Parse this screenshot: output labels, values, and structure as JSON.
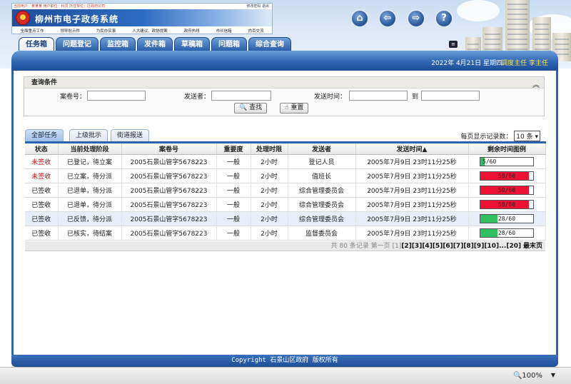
{
  "header": {
    "topnote": "当前用户：某某某  用户职位：科员  所在单位：区政府公司",
    "topnote_right": "修改密码  退出",
    "title": "柳州市电子政务系统",
    "shortcuts": [
      "全面重点工作",
      "领导批示件",
      "为民办实事",
      "人大建议、政协提案",
      "政府热线",
      "市长信箱",
      "内百交流"
    ],
    "icons": [
      "home-icon",
      "back-icon",
      "forward-icon",
      "help-icon"
    ],
    "icon_glyphs": [
      "⌂",
      "⇦",
      "⇨",
      "?"
    ]
  },
  "nav": {
    "tabs": [
      "任务箱",
      "问题登记",
      "监控箱",
      "发件箱",
      "草稿箱",
      "问题箱",
      "综合查询"
    ],
    "active": 0
  },
  "status": {
    "date": "2022年 4月21日 星期四",
    "role": "调度主任 李主任"
  },
  "query": {
    "title": "查询条件",
    "case_no_label": "案卷号：",
    "sender_label": "发送者：",
    "time_label": "发送时间：",
    "to_label": "到",
    "search_button": "查找",
    "reset_button": "重置"
  },
  "subtabs": [
    "全部任务",
    "上级批示",
    "街道报送"
  ],
  "perpage": {
    "label": "每页显示记录数：",
    "value": "10 条"
  },
  "table": {
    "columns": [
      "状态",
      "当前处理阶段",
      "案卷号",
      "重要度",
      "处理时限",
      "发送者",
      "发送时间▲",
      "剩余时间图例"
    ],
    "rows": [
      {
        "status": "未签收",
        "stage": "已登记，待立案",
        "case": "2005石景山管字5678223",
        "importance": "一般",
        "limit": "2小时",
        "sender": "登记人员",
        "time": "2005年7月9日  23时11分25秒",
        "remaining": "5/60",
        "fraction": 0.083,
        "color": "#30c060",
        "red": true
      },
      {
        "status": "未签收",
        "stage": "已立案，待分派",
        "case": "2005石景山管字5678223",
        "importance": "一般",
        "limit": "2小时",
        "sender": "值班长",
        "time": "2005年7月9日  23时11分25秒",
        "remaining": "50/60",
        "fraction": 0.92,
        "color": "#ee1133",
        "red": true
      },
      {
        "status": "已签收",
        "stage": "已退单，待分派",
        "case": "2005石景山管字5678223",
        "importance": "一般",
        "limit": "2小时",
        "sender": "综合管理委员会",
        "time": "2005年7月9日  23时11分25秒",
        "remaining": "50/60",
        "fraction": 0.92,
        "color": "#ee1133",
        "red": false
      },
      {
        "status": "已签收",
        "stage": "已退单，待分派",
        "case": "2005石景山管字5678223",
        "importance": "一般",
        "limit": "2小时",
        "sender": "综合管理委员会",
        "time": "2005年7月9日  23时11分25秒",
        "remaining": "50/60",
        "fraction": 0.92,
        "color": "#ee1133",
        "red": false
      },
      {
        "status": "已签收",
        "stage": "已反馈，待分派",
        "case": "2005石景山管字5678223",
        "importance": "一般",
        "limit": "2小时",
        "sender": "综合管理委员会",
        "time": "2005年7月9日  23时11分25秒",
        "remaining": "28/60",
        "fraction": 0.33,
        "color": "#30c060",
        "red": false,
        "highlight": true
      },
      {
        "status": "已签收",
        "stage": "已核实，待结案",
        "case": "2005石景山管字5678223",
        "importance": "一般",
        "limit": "2小时",
        "sender": "监督委员会",
        "time": "2005年7月9日  23时11分25秒",
        "remaining": "28/60",
        "fraction": 0.33,
        "color": "#30c060",
        "red": false
      }
    ]
  },
  "pager": {
    "summary": "共 80 条记录  第一页",
    "pages": [
      "[1]",
      "[2]",
      "[3]",
      "[4]",
      "[5]",
      "[6]",
      "[7]",
      "[8]",
      "[9]",
      "[10]",
      "...",
      "[20]"
    ],
    "last": "最末页"
  },
  "footer": {
    "copyright": "Copyright 石景山区政府 版权所有"
  },
  "statusbar": {
    "zoom": "🔍100%",
    "zoom_arrow": "▼"
  }
}
